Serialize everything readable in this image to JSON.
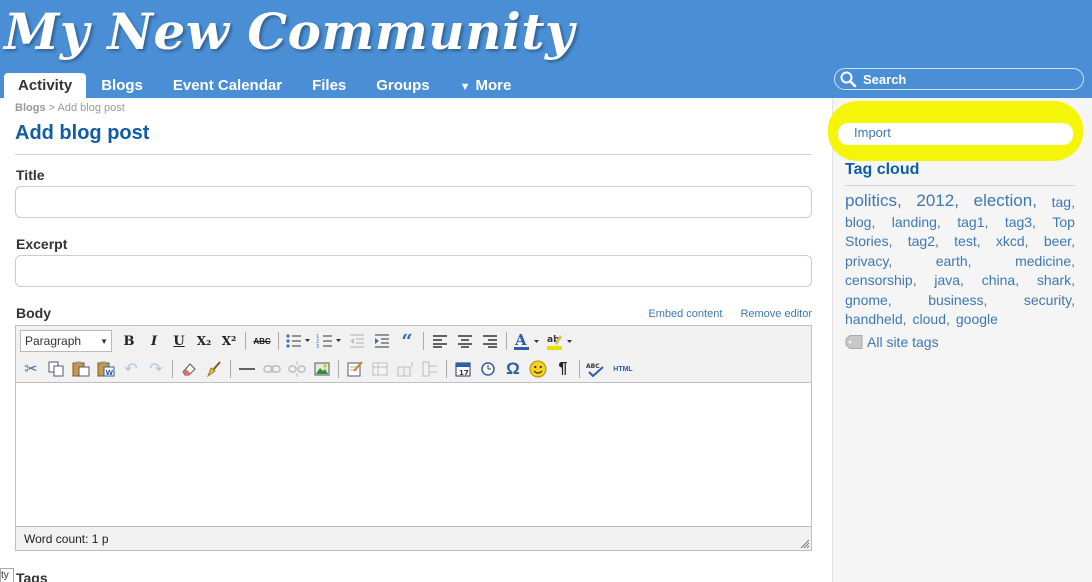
{
  "header": {
    "site_title": "My New Community",
    "nav_tabs": [
      "Activity",
      "Blogs",
      "Event Calendar",
      "Files",
      "Groups"
    ],
    "nav_more": "More",
    "search_placeholder": "Search"
  },
  "breadcrumb": {
    "parent": "Blogs",
    "separator": ">",
    "current": "Add blog post"
  },
  "page_title": "Add blog post",
  "form": {
    "title_label": "Title",
    "excerpt_label": "Excerpt",
    "body_label": "Body",
    "embed_link": "Embed content",
    "remove_editor_link": "Remove editor",
    "format_value": "Paragraph",
    "word_count": "Word count: 1 p",
    "tags_label": "Tags",
    "side_fragment": "ty"
  },
  "toolbar": {
    "bold": "B",
    "italic": "I",
    "underline": "U",
    "subscript": "X₂",
    "superscript": "X²",
    "spellcheck": "ABC",
    "omega": "Ω",
    "pilcrow": "¶",
    "html": "HTML"
  },
  "sidebar": {
    "import_link": "Import",
    "tagcloud_title": "Tag cloud",
    "tag_lines": [
      {
        "tags": [
          "politics,",
          "2012,",
          "election,",
          "tag,"
        ]
      },
      {
        "tags": [
          "blog,",
          "landing,",
          "tag1,",
          "tag3,",
          "Top"
        ]
      },
      {
        "tags": [
          "Stories,",
          "tag2,",
          "test,",
          "xkcd,",
          "beer,"
        ]
      },
      {
        "tags": [
          "privacy,",
          "earth,",
          "medicine,"
        ]
      },
      {
        "tags": [
          "censorship,",
          "java,",
          "china,",
          "shark,"
        ]
      },
      {
        "tags": [
          "gnome,",
          "business,",
          "security,"
        ]
      },
      {
        "tags": [
          "handheld,",
          "cloud,",
          "google"
        ]
      }
    ],
    "all_tags_link": "All site tags"
  },
  "colors": {
    "header_bg": "#4a8fd6",
    "title_blue": "#0f5da5",
    "link_blue": "#3d78b7",
    "highlight_yellow": "#f5f50a"
  }
}
